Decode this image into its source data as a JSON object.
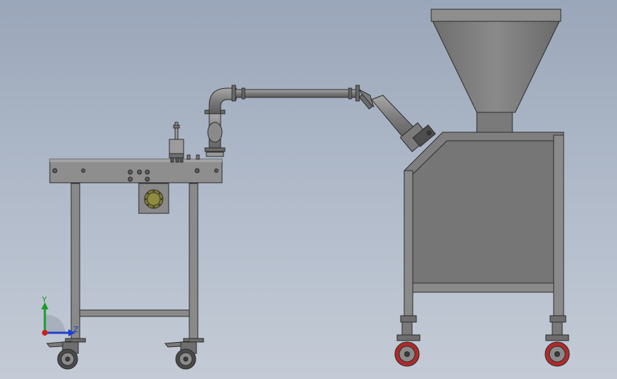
{
  "view": {
    "background_top": "#9aa6b9",
    "background_bottom": "#c4cbd6"
  },
  "triad": {
    "y_label": "Y",
    "z_label": "Z",
    "y_color": "#1a9a2a",
    "z_color": "#1f3fd0",
    "x_color": "#cc1e1e"
  },
  "model": {
    "steel_color": "#7c7c7c",
    "outline_color": "#2c2c2c",
    "wheel_color": "#b02a2a"
  }
}
